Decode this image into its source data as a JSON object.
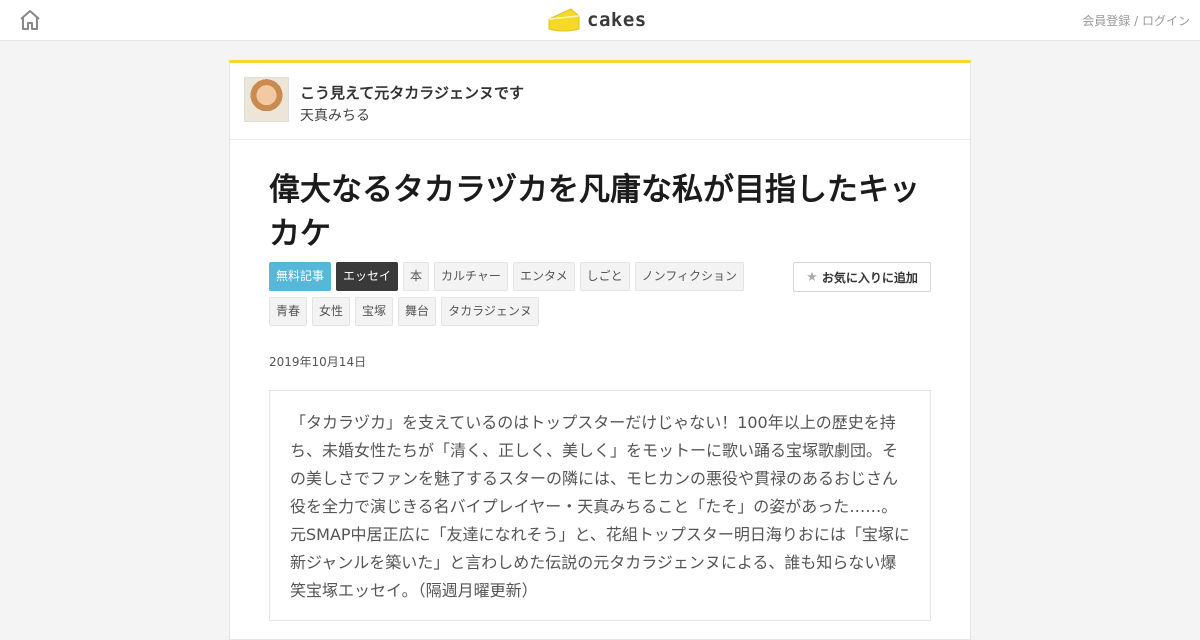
{
  "header": {
    "logo_text": "cakes",
    "auth_register": "会員登録",
    "auth_sep": " / ",
    "auth_login": "ログイン"
  },
  "series": {
    "title": "こう見えて元タカラジェンヌです",
    "author": "天真みちる"
  },
  "article": {
    "title": "偉大なるタカラヅカを凡庸な私が目指したキッカケ",
    "tags": [
      "無料記事",
      "エッセイ",
      "本",
      "カルチャー",
      "エンタメ",
      "しごと",
      "ノンフィクション",
      "青春",
      "女性",
      "宝塚",
      "舞台",
      "タカラジェンヌ"
    ],
    "favorite_label": "お気に入りに追加",
    "date": "2019年10月14日",
    "lead": "「タカラヅカ」を支えているのはトップスターだけじゃない！100年以上の歴史を持ち、未婚女性たちが「清く、正しく、美しく」をモットーに歌い踊る宝塚歌劇団。その美しさでファンを魅了するスターの隣には、モヒカンの悪役や貫禄のあるおじさん役を全力で演じきる名バイプレイヤー・天真みちること「たそ」の姿があった……。元SMAP中居正広に「友達になれそう」と、花組トップスター明日海りおには「宝塚に新ジャンルを築いた」と言わしめた伝説の元タカラジェンヌによる、誰も知らない爆笑宝塚エッセイ。（隔週月曜更新）"
  },
  "colors": {
    "accent_yellow": "#f5d82a",
    "tag_free_bg": "#57b7d9",
    "tag_dark_bg": "#3a3a3a"
  },
  "icons": {
    "home": "home-icon",
    "logo": "cheese-logo-icon",
    "star": "star-icon"
  }
}
